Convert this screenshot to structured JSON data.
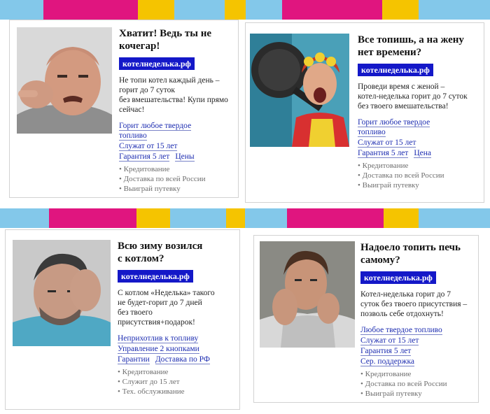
{
  "colors": {
    "stripe": [
      "#83c8ea",
      "#e0157f",
      "#f5c400",
      "#ffffff"
    ],
    "domain_badge": "#1418c8",
    "link": "#1b2bb0",
    "bullet_text": "#6e6e6e"
  },
  "ads": [
    {
      "photo": "angry-man-pointing-photo",
      "title": "Хватит! Ведь ты не\nкочегар!",
      "domain": "котелнеделька.рф",
      "description": "Не топи котел каждый день –\nгорит до 7 суток\nбез вмешательства! Купи прямо\nсейчас!",
      "links": [
        [
          "Горит любое твердое\nтопливо"
        ],
        [
          "Служат от 15 лет"
        ],
        [
          "Гарантия 5 лет",
          "Цены"
        ]
      ],
      "bullets": [
        "Кредитование",
        "Доставка по всей России",
        "Выиграй путевку"
      ]
    },
    {
      "photo": "screaming-woman-with-pan-photo",
      "title": "Все топишь, а на жену\nнет времени?",
      "domain": "котелнеделька.рф",
      "description": "Проведи время с женой –\nкотел-неделька горит до 7 суток\nбез твоего вмешательства!",
      "links": [
        [
          "Горит любое твердое\nтопливо"
        ],
        [
          "Служат от 15 лет"
        ],
        [
          "Гарантия 5 лет",
          "Цена"
        ]
      ],
      "bullets": [
        "Кредитование",
        "Доставка по всей России",
        "Выиграй путевку"
      ]
    },
    {
      "photo": "tired-man-photo",
      "title": "Всю зиму возился\nс котлом?",
      "domain": "котелнеделька.рф",
      "description": "С котлом «Неделька» такого\nне будет-горит до 7 дней\nбез твоего\nприсутствия+подарок!",
      "links": [
        [
          "Неприхотлив к топливу"
        ],
        [
          "Управление 2 кнопками"
        ],
        [
          "Гарантии",
          "Доставка по РФ"
        ]
      ],
      "bullets": [
        "Кредитование",
        "Служит до 15 лет",
        "Тех. обслуживание"
      ]
    },
    {
      "photo": "bored-man-photo",
      "title": "Надоело топить печь\nсамому?",
      "domain": "котелнеделька.рф",
      "description": "Котел-неделька горит до 7\nсуток без твоего присутствия –\nпозволь себе отдохнуть!",
      "links": [
        [
          "Любое твердое топливо"
        ],
        [
          "Служат от 15 лет"
        ],
        [
          "Гарантия 5 лет"
        ],
        [
          "Сер. поддержка"
        ]
      ],
      "bullets": [
        "Кредитование",
        "Доставка по всей России",
        "Выиграй путевку"
      ]
    }
  ]
}
